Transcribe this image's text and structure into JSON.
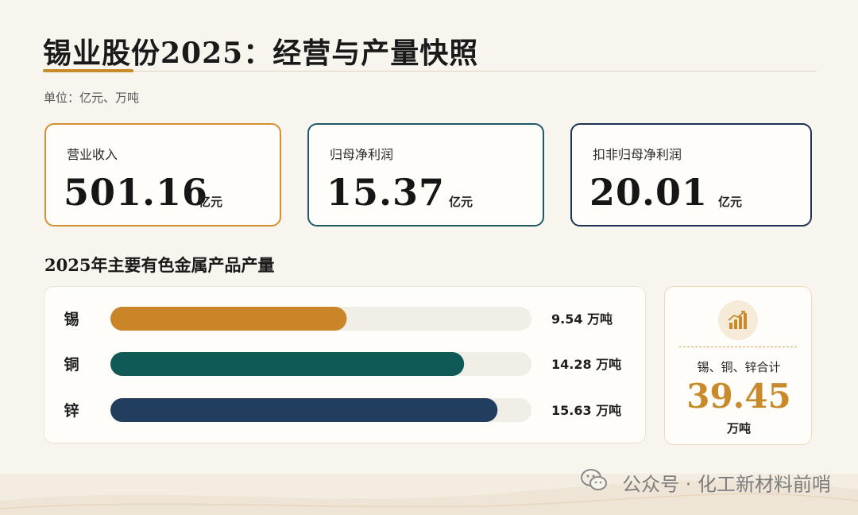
{
  "header": {
    "title": "锡业股份2025：经营与产量快照",
    "unit": "单位：亿元、万吨"
  },
  "kpis": [
    {
      "label": "营业收入",
      "value": "501.16",
      "unit": "亿元"
    },
    {
      "label": "归母净利润",
      "value": "15.37",
      "unit": "亿元"
    },
    {
      "label": "扣非归母净利润",
      "value": "20.01",
      "unit": "亿元"
    }
  ],
  "colors": {
    "tin": "#c98527",
    "copper": "#0f5a57",
    "zinc": "#213e5e",
    "accent": "#c98a2c",
    "track": "#f1ede7"
  },
  "chart_data": {
    "type": "bar",
    "title": "2025年主要有色金属产品产量",
    "orientation": "horizontal",
    "categories": [
      "锡",
      "铜",
      "锌"
    ],
    "values": [
      9.54,
      14.28,
      15.63
    ],
    "value_labels": [
      "9.54 万吨",
      "14.28 万吨",
      "15.63 万吨"
    ],
    "unit": "万吨",
    "xlim": [
      0,
      17
    ],
    "grid": false,
    "legend": "none"
  },
  "summary": {
    "label": "锡、铜、锌合计",
    "value": "39.45",
    "unit": "万吨",
    "icon": "bar-chart-icon"
  },
  "watermark": {
    "icon": "wechat-icon",
    "text": "公众号 · 化工新材料前哨"
  }
}
